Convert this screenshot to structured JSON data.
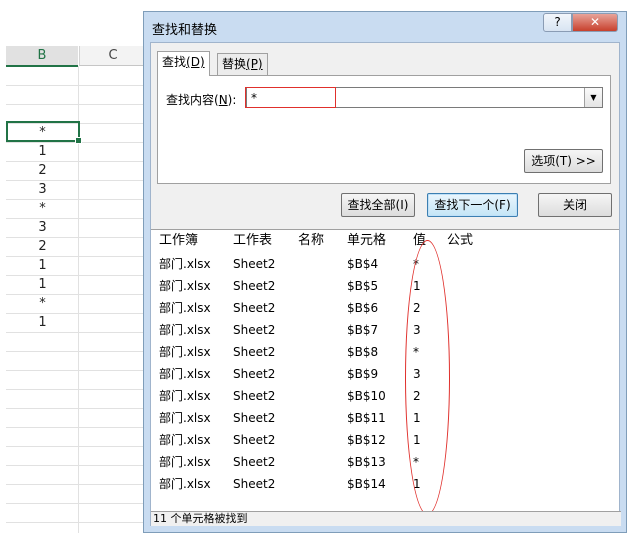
{
  "sheet": {
    "col_b": "B",
    "col_c": "C",
    "cells": [
      "*",
      "1",
      "2",
      "3",
      "*",
      "3",
      "2",
      "1",
      "1",
      "*",
      "1"
    ]
  },
  "dialog": {
    "title": "查找和替换",
    "help_label": "?",
    "close_label": "✕",
    "tabs": {
      "find": {
        "label": "查找",
        "accel": "(D)"
      },
      "replace": {
        "label": "替换",
        "accel": "(P)"
      }
    },
    "find_what": {
      "label": "查找内容(",
      "accel": "N",
      "suffix": "):",
      "value": "*"
    },
    "combo_arrow": "▼",
    "options_label": "选项(T) >>",
    "buttons": {
      "find_all": "查找全部(I)",
      "find_next": "查找下一个(F)",
      "close": "关闭"
    },
    "columns": [
      "工作簿",
      "工作表",
      "名称",
      "单元格",
      "值",
      "公式"
    ],
    "results": [
      {
        "book": "部门.xlsx",
        "sheet": "Sheet2",
        "name": "",
        "cell": "$B$4",
        "value": "*",
        "formula": ""
      },
      {
        "book": "部门.xlsx",
        "sheet": "Sheet2",
        "name": "",
        "cell": "$B$5",
        "value": "1",
        "formula": ""
      },
      {
        "book": "部门.xlsx",
        "sheet": "Sheet2",
        "name": "",
        "cell": "$B$6",
        "value": "2",
        "formula": ""
      },
      {
        "book": "部门.xlsx",
        "sheet": "Sheet2",
        "name": "",
        "cell": "$B$7",
        "value": "3",
        "formula": ""
      },
      {
        "book": "部门.xlsx",
        "sheet": "Sheet2",
        "name": "",
        "cell": "$B$8",
        "value": "*",
        "formula": ""
      },
      {
        "book": "部门.xlsx",
        "sheet": "Sheet2",
        "name": "",
        "cell": "$B$9",
        "value": "3",
        "formula": ""
      },
      {
        "book": "部门.xlsx",
        "sheet": "Sheet2",
        "name": "",
        "cell": "$B$10",
        "value": "2",
        "formula": ""
      },
      {
        "book": "部门.xlsx",
        "sheet": "Sheet2",
        "name": "",
        "cell": "$B$11",
        "value": "1",
        "formula": ""
      },
      {
        "book": "部门.xlsx",
        "sheet": "Sheet2",
        "name": "",
        "cell": "$B$12",
        "value": "1",
        "formula": ""
      },
      {
        "book": "部门.xlsx",
        "sheet": "Sheet2",
        "name": "",
        "cell": "$B$13",
        "value": "*",
        "formula": ""
      },
      {
        "book": "部门.xlsx",
        "sheet": "Sheet2",
        "name": "",
        "cell": "$B$14",
        "value": "1",
        "formula": ""
      }
    ],
    "status": "11 个单元格被找到"
  }
}
